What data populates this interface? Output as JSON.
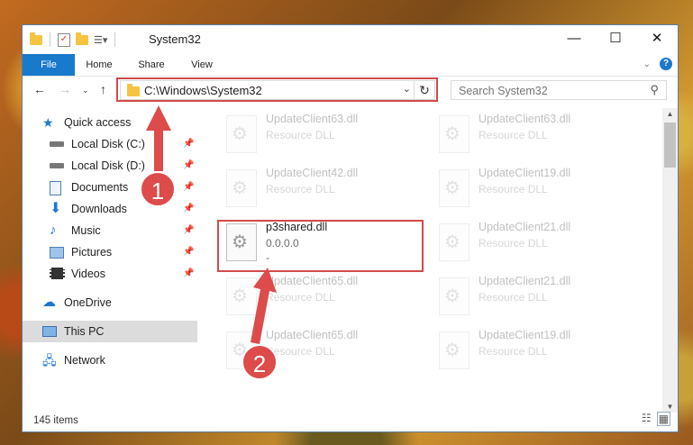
{
  "window": {
    "title": "System32"
  },
  "ribbon": {
    "tabs": [
      "File",
      "Home",
      "Share",
      "View"
    ],
    "help": "?"
  },
  "window_buttons": {
    "minimize": "—",
    "maximize": "☐",
    "close": "✕"
  },
  "address": {
    "path": "C:\\Windows\\System32",
    "search_placeholder": "Search System32"
  },
  "sidebar": {
    "quick_access": "Quick access",
    "items": [
      {
        "label": "Local Disk (C:)",
        "icon": "drive-icon"
      },
      {
        "label": "Local Disk (D:)",
        "icon": "drive-icon"
      },
      {
        "label": "Documents",
        "icon": "documents-icon"
      },
      {
        "label": "Downloads",
        "icon": "downloads-icon"
      },
      {
        "label": "Music",
        "icon": "music-icon"
      },
      {
        "label": "Pictures",
        "icon": "pictures-icon"
      },
      {
        "label": "Videos",
        "icon": "videos-icon"
      }
    ],
    "onedrive": "OneDrive",
    "this_pc": "This PC",
    "network": "Network"
  },
  "files": [
    {
      "name": "UpdateClient63.dll",
      "desc": "Resource DLL"
    },
    {
      "name": "UpdateClient63.dll",
      "desc": "Resource DLL"
    },
    {
      "name": "UpdateClient42.dll",
      "desc": "Resource DLL"
    },
    {
      "name": "UpdateClient19.dll",
      "desc": "Resource DLL"
    },
    {
      "name": "p3shared.dll",
      "desc": "0.0.0.0",
      "desc2": "-"
    },
    {
      "name": "UpdateClient21.dll",
      "desc": "Resource DLL"
    },
    {
      "name": "UpdateClient65.dll",
      "desc": "Resource DLL"
    },
    {
      "name": "UpdateClient21.dll",
      "desc": "Resource DLL"
    },
    {
      "name": "UpdateClient65.dll",
      "desc": "Resource DLL"
    },
    {
      "name": "UpdateClient19.dll",
      "desc": "Resource DLL"
    }
  ],
  "status": {
    "item_count": "145 items"
  },
  "annotations": {
    "step1": "1",
    "step2": "2",
    "color": "#dd4b4b"
  }
}
